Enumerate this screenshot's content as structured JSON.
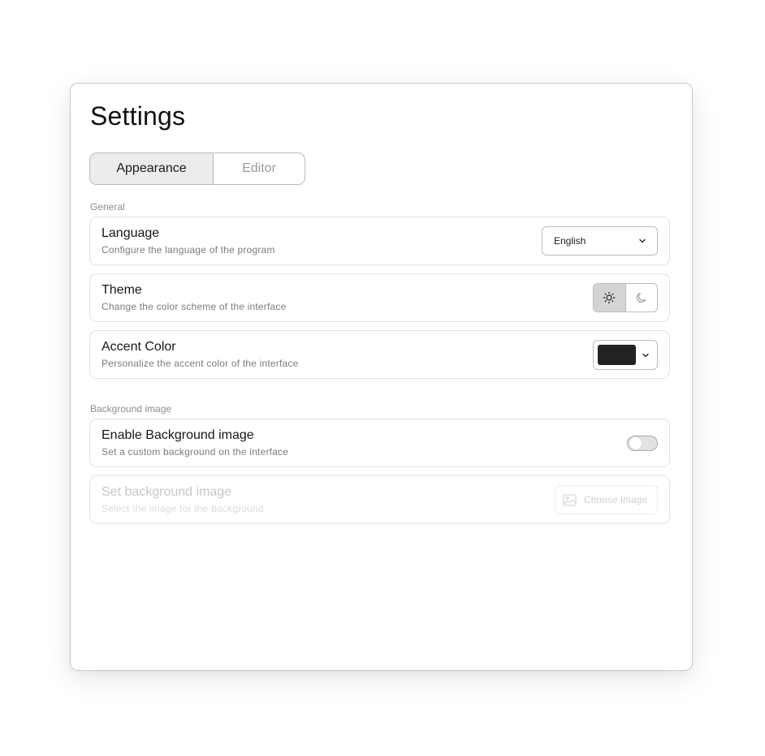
{
  "title": "Settings",
  "tabs": [
    {
      "label": "Appearance",
      "active": true
    },
    {
      "label": "Editor",
      "active": false
    }
  ],
  "sections": {
    "general": "General",
    "background": "Background image"
  },
  "language": {
    "title": "Language",
    "description": "Configure the language of the program",
    "value": "English"
  },
  "theme": {
    "title": "Theme",
    "description": "Change the color scheme of the interface",
    "selected": "light",
    "icons": [
      "sun-icon",
      "moon-icon"
    ]
  },
  "accent": {
    "title": "Accent Color",
    "description": "Personalize the accent color of the interface",
    "color": "#222222"
  },
  "enable_bg": {
    "title": "Enable Background image",
    "description": "Set a custom background on the interface",
    "enabled": false
  },
  "set_bg": {
    "title": "Set background image",
    "description": "Select the image for the background",
    "button_label": "Choose Image",
    "disabled": true
  }
}
